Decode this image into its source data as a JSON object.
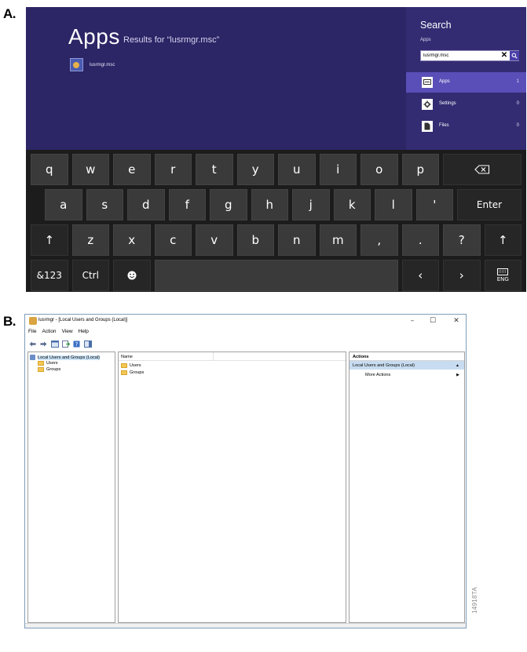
{
  "labels": {
    "a": "A.",
    "b": "B."
  },
  "start_screen": {
    "title": "Apps",
    "results_text": "Results for “lusrmgr.msc”",
    "result_item": "lusrmgr.msc",
    "search_charm": {
      "title": "Search",
      "scope": "Apps",
      "query": "lusrmgr.msc",
      "categories": [
        {
          "label": "Apps",
          "count": "1",
          "icon": "apps-icon"
        },
        {
          "label": "Settings",
          "count": "0",
          "icon": "settings-icon"
        },
        {
          "label": "Files",
          "count": "0",
          "icon": "files-icon"
        }
      ]
    },
    "keyboard": {
      "row1": [
        "q",
        "w",
        "e",
        "r",
        "t",
        "y",
        "u",
        "i",
        "o",
        "p"
      ],
      "row2": [
        "a",
        "s",
        "d",
        "f",
        "g",
        "h",
        "j",
        "k",
        "l",
        "'"
      ],
      "enter": "Enter",
      "row3": [
        "z",
        "x",
        "c",
        "v",
        "b",
        "n",
        "m",
        ",",
        ".",
        "?"
      ],
      "num_key": "&123",
      "ctrl_key": "Ctrl",
      "lang": "ENG"
    }
  },
  "mmc": {
    "title": "lusrmgr - [Local Users and Groups (Local)]",
    "menu": [
      "File",
      "Action",
      "View",
      "Help"
    ],
    "tree": {
      "root": "Local Users and Groups (Local)",
      "children": [
        "Users",
        "Groups"
      ]
    },
    "list": {
      "column": "Name",
      "rows": [
        "Users",
        "Groups"
      ]
    },
    "actions": {
      "header": "Actions",
      "section": "Local Users and Groups (Local)",
      "item": "More Actions"
    }
  },
  "figure_code": "14918TA"
}
